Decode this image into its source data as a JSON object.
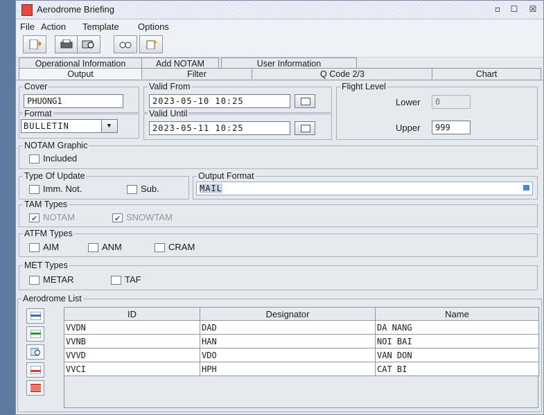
{
  "window": {
    "title": "Aerodrome Briefing"
  },
  "menu": [
    "File",
    "Action",
    "Template",
    "Options"
  ],
  "toolbar": [
    "new-document-icon",
    "print-icon",
    "search-icon",
    "glasses-icon",
    "sparkle-document-icon"
  ],
  "tabs_row1": [
    "Operational Information",
    "Add NOTAM",
    "User Information"
  ],
  "tabs_row2": [
    "Output",
    "Filter",
    "Q Code 2/3",
    "Chart"
  ],
  "active_tab": "Output",
  "cover": {
    "label": "Cover",
    "value": "PHUONG1"
  },
  "valid_from": {
    "label": "Valid From",
    "value": "2023-05-10 10:25"
  },
  "valid_until": {
    "label": "Valid Until",
    "value": "2023-05-11 10:25"
  },
  "format": {
    "label": "Format",
    "value": "BULLETIN"
  },
  "flight_level": {
    "label": "Flight Level",
    "lower_label": "Lower",
    "lower_value": "0",
    "upper_label": "Upper",
    "upper_value": "999"
  },
  "notam_graphic": {
    "label": "NOTAM Graphic",
    "included": "Included"
  },
  "type_of_update": {
    "label": "Type Of Update",
    "imm": "Imm. Not.",
    "sub": "Sub."
  },
  "output_format": {
    "label": "Output Format",
    "value": "MAIL"
  },
  "tam_types": {
    "label": "TAM Types",
    "notam": "NOTAM",
    "snowtam": "SNOWTAM"
  },
  "atfm_types": {
    "label": "ATFM Types",
    "aim": "AIM",
    "anm": "ANM",
    "cram": "CRAM"
  },
  "met_types": {
    "label": "MET Types",
    "metar": "METAR",
    "taf": "TAF"
  },
  "aerodrome_list": {
    "label": "Aerodrome List",
    "columns": [
      "ID",
      "Designator",
      "Name"
    ],
    "rows": [
      [
        "VVDN",
        "DAD",
        "DA NANG"
      ],
      [
        "VVNB",
        "HAN",
        "NOI BAI"
      ],
      [
        "VVVD",
        "VDO",
        "VAN DON"
      ],
      [
        "VVCI",
        "HPH",
        "CAT BI"
      ]
    ]
  },
  "colors": {
    "background": "#5d7aa0",
    "panel": "#e6e9ee",
    "border": "#8b96a8"
  }
}
